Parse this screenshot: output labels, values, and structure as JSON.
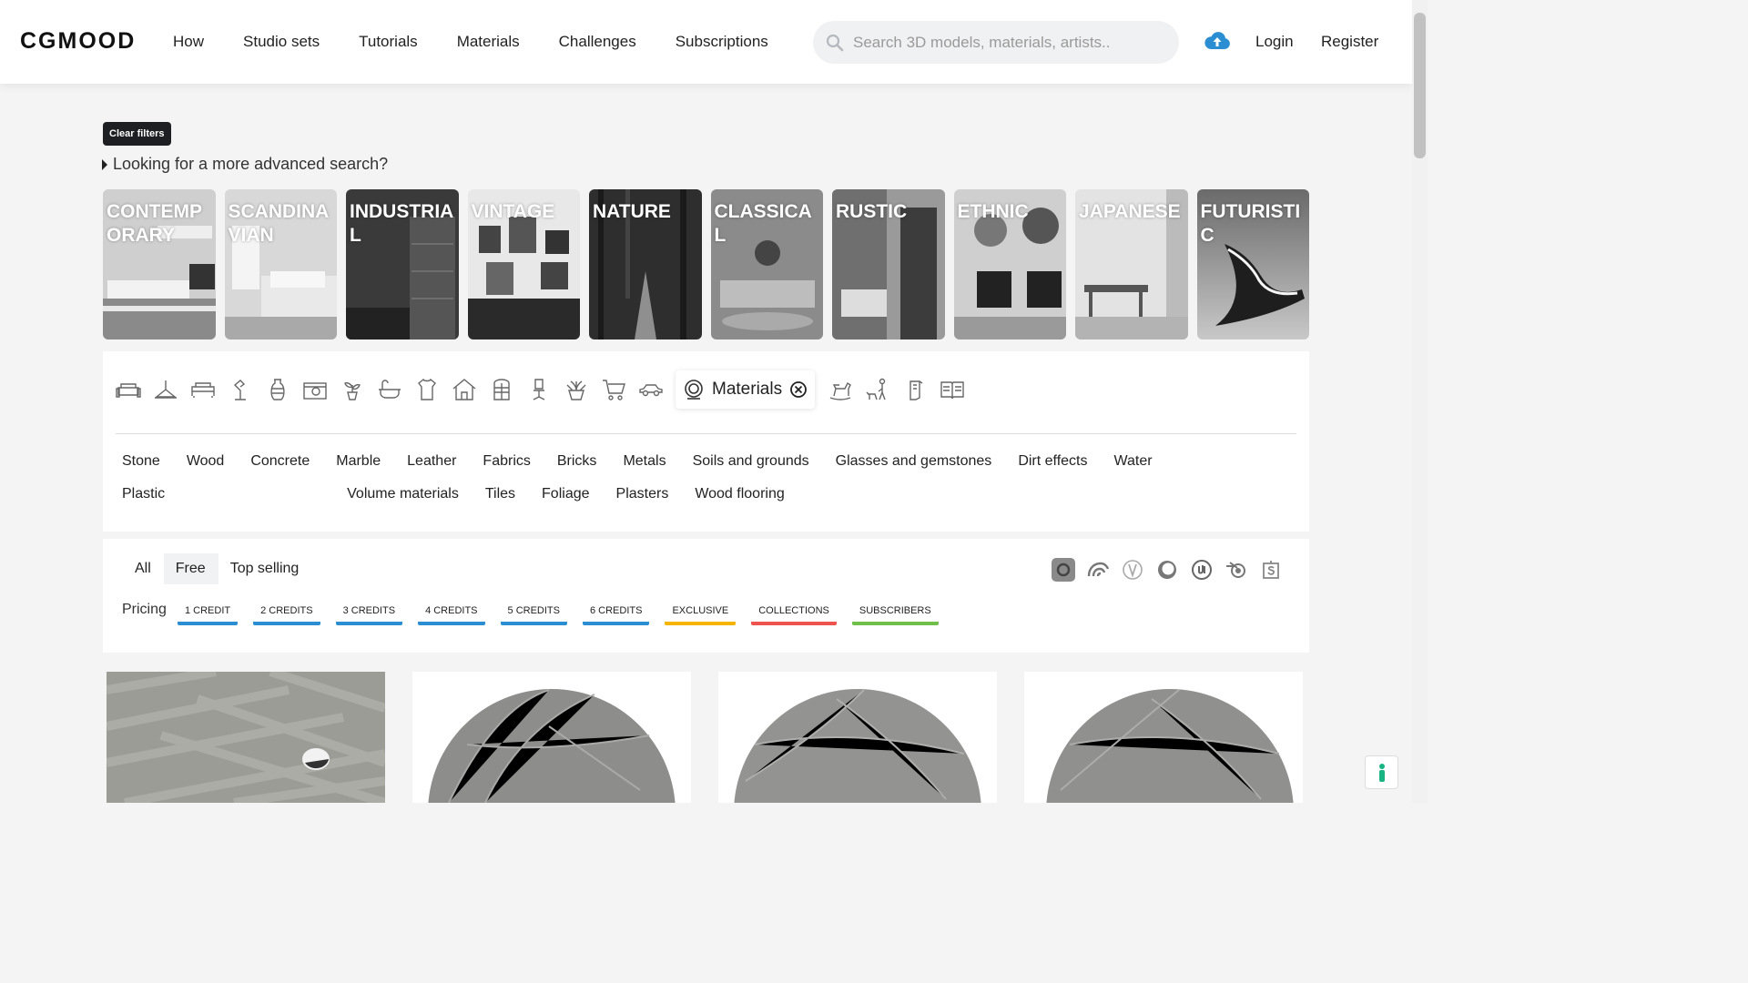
{
  "header": {
    "logo": "CGMOOD",
    "nav": [
      "How",
      "Studio sets",
      "Tutorials",
      "Materials",
      "Challenges",
      "Subscriptions"
    ],
    "search_placeholder": "Search 3D models, materials, artists..",
    "login": "Login",
    "register": "Register"
  },
  "filters": {
    "clear_label": "Clear filters",
    "advanced_label": "Looking for a more advanced search?"
  },
  "styles": [
    "CONTEMPORARY",
    "SCANDINAVIAN",
    "INDUSTRIAL",
    "VINTAGE",
    "NATURE",
    "CLASSICAL",
    "RUSTIC",
    "ETHNIC",
    "JAPANESE",
    "FUTURISTIC"
  ],
  "categories": {
    "icons": [
      "sofa-icon",
      "lamp-icon",
      "bed-icon",
      "desk-lamp-icon",
      "vase-icon",
      "kitchen-icon",
      "plant-icon",
      "bathtub-icon",
      "clothing-icon",
      "house-icon",
      "wardrobe-icon",
      "office-chair-icon",
      "flower-pot-icon",
      "cart-icon",
      "car-icon"
    ],
    "active_label": "Materials",
    "icons_after": [
      "rocking-horse-icon",
      "person-dog-icon",
      "appliance-icon",
      "book-icon"
    ]
  },
  "subcategories": [
    "Stone",
    "Wood",
    "Concrete",
    "Marble",
    "Leather",
    "Fabrics",
    "Bricks",
    "Metals",
    "Soils and grounds",
    "Glasses and gemstones",
    "Dirt effects",
    "Water",
    "Plastic",
    "Volume materials",
    "Tiles",
    "Foliage",
    "Plasters",
    "Wood flooring"
  ],
  "tabs": {
    "items": [
      "All",
      "Free",
      "Top selling"
    ],
    "active": "Free"
  },
  "pricing": {
    "label": "Pricing",
    "chips": [
      {
        "label": "1 CREDIT",
        "color": "#2b8ed3"
      },
      {
        "label": "2 CREDITS",
        "color": "#2b8ed3"
      },
      {
        "label": "3 CREDITS",
        "color": "#2b8ed3"
      },
      {
        "label": "4 CREDITS",
        "color": "#2b8ed3"
      },
      {
        "label": "5 CREDITS",
        "color": "#2b8ed3"
      },
      {
        "label": "6 CREDITS",
        "color": "#2b8ed3"
      },
      {
        "label": "EXCLUSIVE",
        "color": "#f5b400"
      },
      {
        "label": "COLLECTIONS",
        "color": "#ef5350"
      },
      {
        "label": "SUBSCRIBERS",
        "color": "#6fbf4a"
      }
    ]
  },
  "engines": [
    "3dsmax-icon",
    "cinema4d-icon",
    "vray-icon",
    "corona-icon",
    "unreal-icon",
    "blender-icon",
    "substance-icon"
  ],
  "colors": {
    "accent_blue": "#2b8ed3",
    "help_green": "#17b383"
  }
}
